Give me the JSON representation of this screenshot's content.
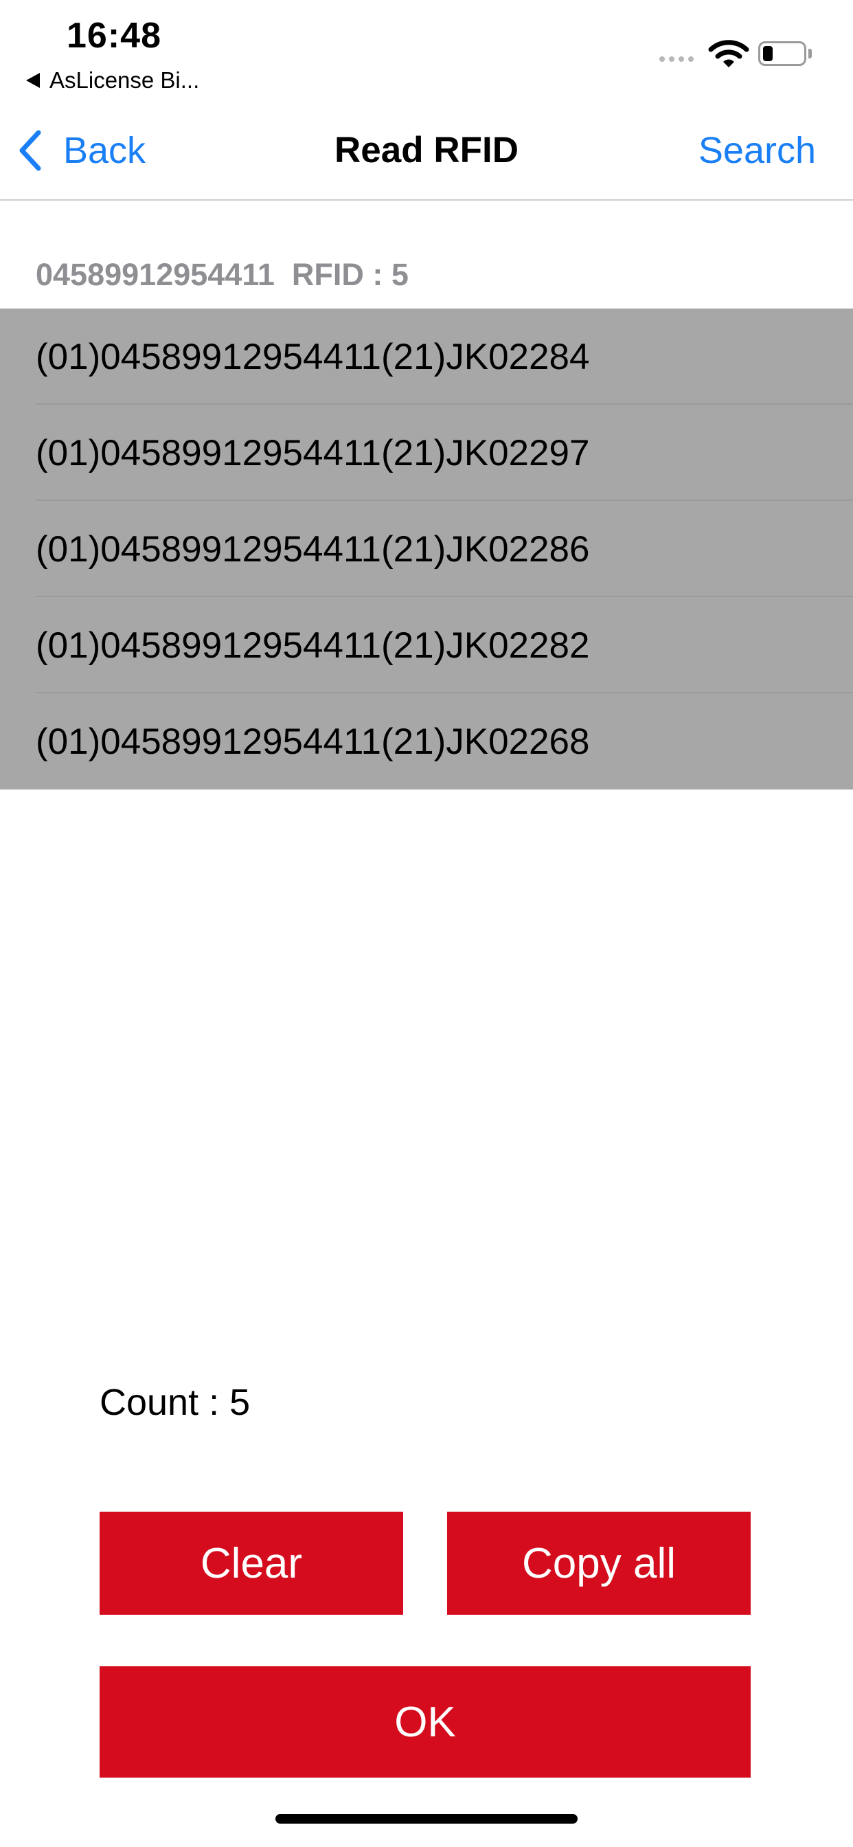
{
  "status_bar": {
    "time": "16:48",
    "back_app": "AsLicense Bi..."
  },
  "nav": {
    "back_label": "Back",
    "title": "Read RFID",
    "search_label": "Search"
  },
  "section": {
    "header": "04589912954411  RFID : 5"
  },
  "rfid_items": [
    "(01)04589912954411(21)JK02284",
    "(01)04589912954411(21)JK02297",
    "(01)04589912954411(21)JK02286",
    "(01)04589912954411(21)JK02282",
    "(01)04589912954411(21)JK02268"
  ],
  "count_label": "Count : 5",
  "buttons": {
    "clear": "Clear",
    "copy_all": "Copy all",
    "ok": "OK"
  },
  "colors": {
    "accent": "#1a7ff5",
    "button": "#d50c1d",
    "list_background": "#a7a7a7",
    "header_text": "#8e8e93"
  }
}
